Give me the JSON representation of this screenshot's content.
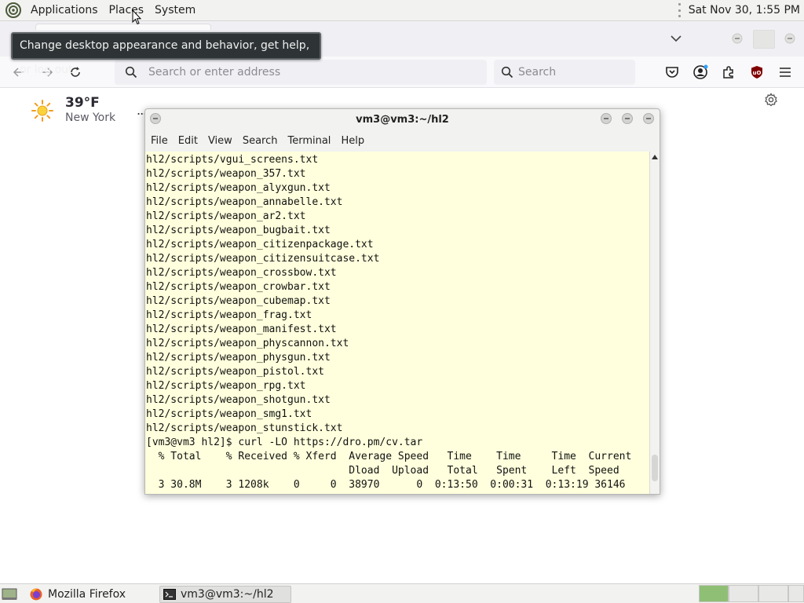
{
  "top_panel": {
    "menus": [
      "Applications",
      "Places",
      "System"
    ],
    "clock": "Sat Nov 30,  1:55 PM"
  },
  "tooltip": "Change desktop appearance and behavior, get help, or log out",
  "browser": {
    "url_placeholder": "Search or enter address",
    "search_placeholder": "Search",
    "weather": {
      "temp": "39°F",
      "city": "New York",
      "more": "..."
    }
  },
  "terminal": {
    "title": "vm3@vm3:~/hl2",
    "menu": [
      "File",
      "Edit",
      "View",
      "Search",
      "Terminal",
      "Help"
    ],
    "lines": [
      "hl2/scripts/vgui_screens.txt",
      "hl2/scripts/weapon_357.txt",
      "hl2/scripts/weapon_alyxgun.txt",
      "hl2/scripts/weapon_annabelle.txt",
      "hl2/scripts/weapon_ar2.txt",
      "hl2/scripts/weapon_bugbait.txt",
      "hl2/scripts/weapon_citizenpackage.txt",
      "hl2/scripts/weapon_citizensuitcase.txt",
      "hl2/scripts/weapon_crossbow.txt",
      "hl2/scripts/weapon_crowbar.txt",
      "hl2/scripts/weapon_cubemap.txt",
      "hl2/scripts/weapon_frag.txt",
      "hl2/scripts/weapon_manifest.txt",
      "hl2/scripts/weapon_physcannon.txt",
      "hl2/scripts/weapon_physgun.txt",
      "hl2/scripts/weapon_pistol.txt",
      "hl2/scripts/weapon_rpg.txt",
      "hl2/scripts/weapon_shotgun.txt",
      "hl2/scripts/weapon_smg1.txt",
      "hl2/scripts/weapon_stunstick.txt",
      "[vm3@vm3 hl2]$ curl -LO https://dro.pm/cv.tar",
      "  % Total    % Received % Xferd  Average Speed   Time    Time     Time  Current",
      "                                 Dload  Upload   Total   Spent    Left  Speed",
      "  3 30.8M    3 1208k    0     0  38970      0  0:13:50  0:00:31  0:13:19 36146"
    ]
  },
  "taskbar": {
    "tasks": [
      "Mozilla Firefox",
      "vm3@vm3:~/hl2"
    ]
  }
}
